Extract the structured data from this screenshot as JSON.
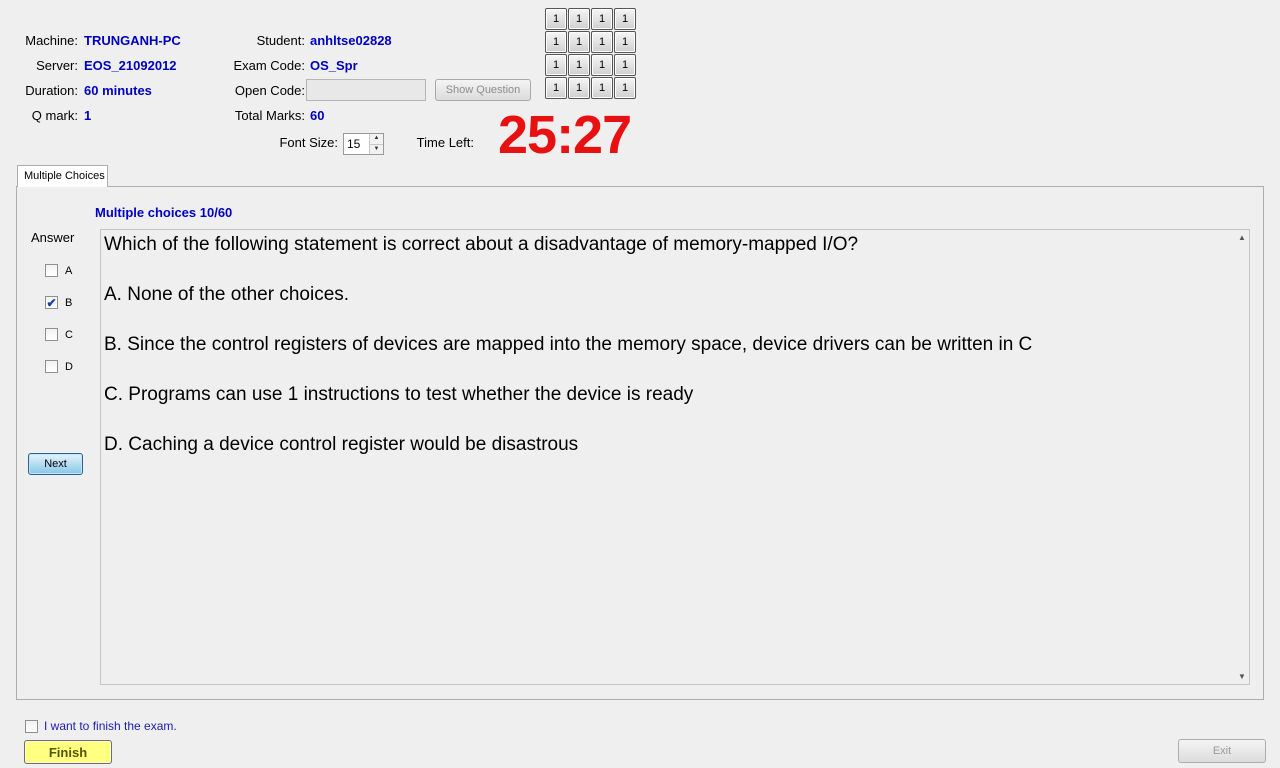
{
  "info": {
    "machine_label": "Machine:",
    "machine_value": "TRUNGANH-PC",
    "server_label": "Server:",
    "server_value": "EOS_21092012",
    "duration_label": "Duration:",
    "duration_value": "60 minutes",
    "qmark_label": "Q mark:",
    "qmark_value": "1",
    "student_label": "Student:",
    "student_value": "anhltse02828",
    "examcode_label": "Exam Code:",
    "examcode_value": "OS_Spr",
    "opencode_label": "Open Code:",
    "opencode_value": "",
    "totalmarks_label": "Total Marks:",
    "totalmarks_value": "60",
    "fontsize_label": "Font Size:",
    "fontsize_value": "15",
    "timeleft_label": "Time Left:"
  },
  "show_question_button": "Show Question",
  "timer": "25:27",
  "question_grid": [
    "1",
    "1",
    "1",
    "1",
    "1",
    "1",
    "1",
    "1",
    "1",
    "1",
    "1",
    "1",
    "1",
    "1",
    "1",
    "1"
  ],
  "tab_label": "Multiple Choices",
  "section_title": "Multiple choices 10/60",
  "answer_label": "Answer",
  "options": [
    {
      "letter": "A",
      "checked": false
    },
    {
      "letter": "B",
      "checked": true
    },
    {
      "letter": "C",
      "checked": false
    },
    {
      "letter": "D",
      "checked": false
    }
  ],
  "next_button": "Next",
  "question": {
    "text": "Which of the following statement is correct about a disadvantage of memory-mapped I/O?",
    "a": "A.  None of the other choices.",
    "b": "B.  Since the control registers of devices are mapped into the memory space, device drivers can be written in C",
    "c": "C.  Programs can use 1 instructions to test whether the device is ready",
    "d": "D.  Caching a device control register would be disastrous"
  },
  "finish_checkbox_label": "I want to finish the exam.",
  "finish_button": "Finish",
  "exit_button": "Exit"
}
